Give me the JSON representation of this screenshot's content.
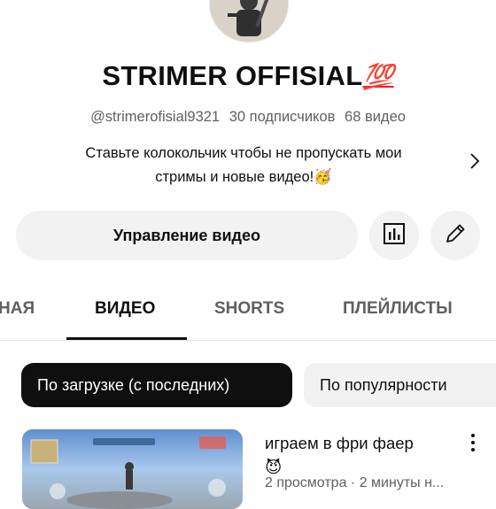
{
  "channel": {
    "name": "STRIMER OFFISIAL",
    "name_emoji": "💯",
    "handle": "@strimerofisial9321",
    "subscribers": "30 подписчиков",
    "videos_count": "68 видео",
    "description_line1": "Ставьте колокольчик чтобы не пропускать мои",
    "description_line2": "стримы и новые видео!🥳"
  },
  "actions": {
    "manage_videos_label": "Управление видео",
    "analytics_icon": "analytics-icon",
    "edit_icon": "pencil-icon"
  },
  "tabs": [
    {
      "label": "НАЯ"
    },
    {
      "label": "ВИДЕО"
    },
    {
      "label": "SHORTS"
    },
    {
      "label": "ПЛЕЙЛИСТЫ"
    }
  ],
  "sort_chips": [
    {
      "label": "По загрузке (с последних)"
    },
    {
      "label": "По популярности"
    }
  ],
  "videos": [
    {
      "title_line1": "играем в фри фаер",
      "title_emoji": "😈",
      "meta": "2 просмотра · 2 минуты н..."
    }
  ],
  "colors": {
    "text_primary": "#0f0f0f",
    "text_secondary": "#606060",
    "chip_bg": "#f2f2f2",
    "accent_100": "#e8202a"
  }
}
